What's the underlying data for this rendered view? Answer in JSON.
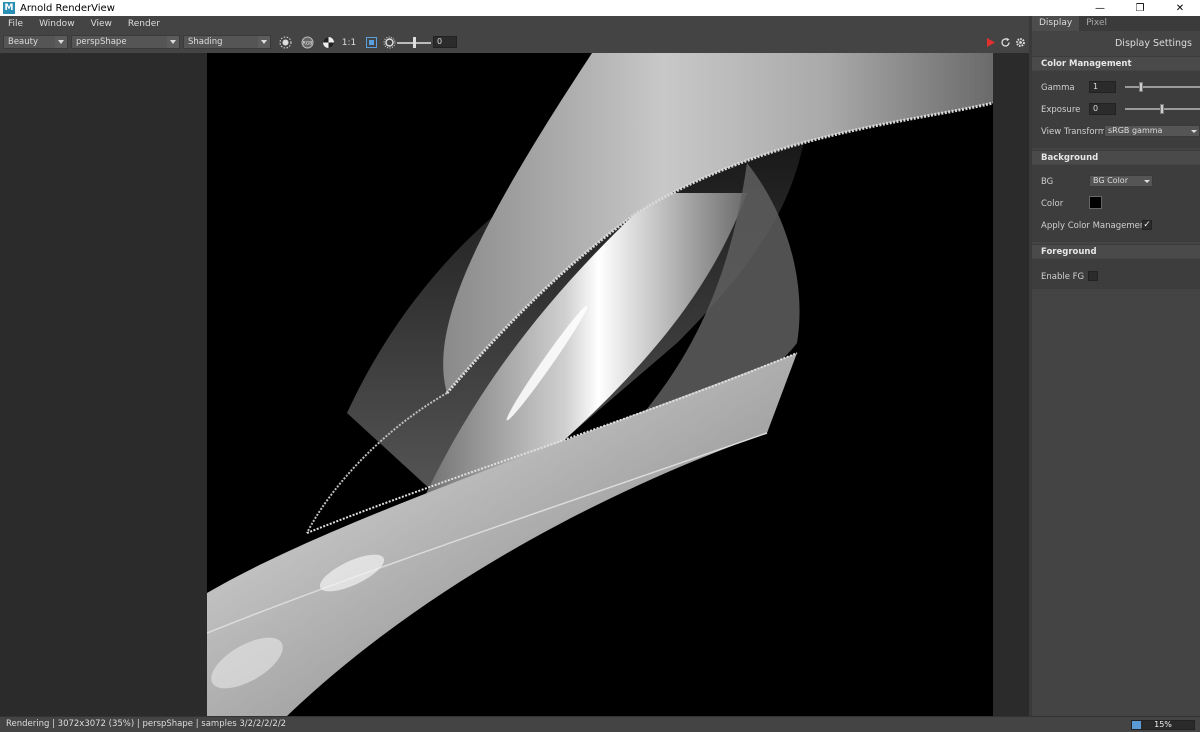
{
  "window": {
    "title": "Arnold RenderView"
  },
  "menu": [
    "File",
    "Window",
    "View",
    "Render"
  ],
  "toolbar": {
    "aov": "Beauty",
    "camera": "perspShape",
    "shading": "Shading",
    "ratio": "1:1",
    "exposure_value": "0"
  },
  "panel": {
    "tabs": [
      "Display",
      "Pixel"
    ],
    "title": "Display Settings",
    "color_management": {
      "header": "Color Management",
      "gamma_label": "Gamma",
      "gamma_value": "1",
      "exposure_label": "Exposure",
      "exposure_value": "0",
      "view_transform_label": "View Transform",
      "view_transform_value": "sRGB gamma"
    },
    "background": {
      "header": "Background",
      "bg_label": "BG",
      "bg_value": "BG Color",
      "color_label": "Color",
      "color_value": "#000000",
      "apply_cm_label": "Apply Color Management",
      "apply_cm_checked": true,
      "check_glyph": "✓"
    },
    "foreground": {
      "header": "Foreground",
      "enable_fg_label": "Enable FG",
      "enable_fg_checked": false
    }
  },
  "status": {
    "text": "Rendering | 3072x3072 (35%) | perspShape  | samples 3/2/2/2/2/2",
    "progress_percent": 15,
    "progress_label": "15%"
  },
  "colors": {
    "accent_stop": "#e03030",
    "progress": "#5a9bd5"
  }
}
